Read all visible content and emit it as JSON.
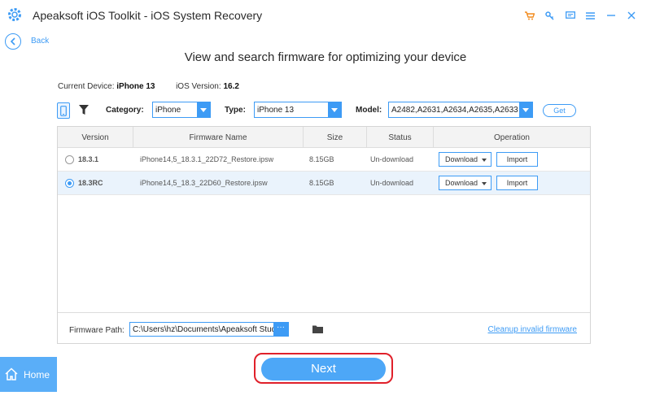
{
  "window": {
    "title": "Apeaksoft iOS Toolkit - iOS System Recovery"
  },
  "nav": {
    "back_label": "Back"
  },
  "page": {
    "heading": "View and search firmware for optimizing your device"
  },
  "device": {
    "current_label": "Current Device:",
    "current_value": "iPhone 13",
    "ios_label": "iOS Version:",
    "ios_value": "16.2"
  },
  "filters": {
    "category_label": "Category:",
    "category_value": "iPhone",
    "type_label": "Type:",
    "type_value": "iPhone 13",
    "model_label": "Model:",
    "model_value": "A2482,A2631,A2634,A2635,A2633",
    "get_label": "Get"
  },
  "table": {
    "columns": [
      "Version",
      "Firmware Name",
      "Size",
      "Status",
      "Operation"
    ],
    "rows": [
      {
        "version": "18.3.1",
        "firmware": "iPhone14,5_18.3.1_22D72_Restore.ipsw",
        "size": "8.15GB",
        "status": "Un-download",
        "download": "Download",
        "import": "Import",
        "selected": false
      },
      {
        "version": "18.3RC",
        "firmware": "iPhone14,5_18.3_22D60_Restore.ipsw",
        "size": "8.15GB",
        "status": "Un-download",
        "download": "Download",
        "import": "Import",
        "selected": true
      }
    ]
  },
  "footer": {
    "path_label": "Firmware Path:",
    "path_value": "C:\\Users\\hz\\Documents\\Apeaksoft Studio\\A",
    "browse_label": "···",
    "cleanup_label": "Cleanup invalid firmware"
  },
  "bottom": {
    "home_label": "Home",
    "next_label": "Next"
  },
  "colors": {
    "accent": "#3d9bf5",
    "next_bg": "#4da7f7",
    "highlight": "#e0202a"
  }
}
